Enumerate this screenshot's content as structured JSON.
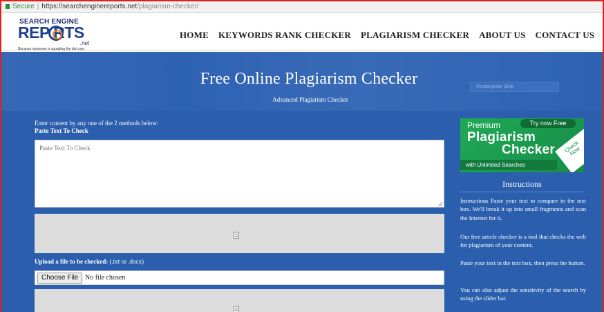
{
  "browser": {
    "secure_label": "Secure",
    "url_host": "https://searchenginereports.net",
    "url_path": "/plagiarism-checker/"
  },
  "logo": {
    "line1": "SEARCH      ENGINE",
    "line2": "REP    RTS",
    "line3": ".net",
    "tagline": "Because someone is squatting the dot com."
  },
  "nav": {
    "items": [
      "HOME",
      "KEYWORDS RANK CHECKER",
      "PLAGIARISM CHECKER",
      "ABOUT US",
      "CONTACT US"
    ]
  },
  "hero": {
    "title": "Free Online Plagiarism Checker",
    "subtitle": "Advanced Plagiarism Checker",
    "promo_text": "Rectangular Strip"
  },
  "main": {
    "intro": "Enter content by any one of the 2 methods below:",
    "paste_heading": "Paste Text To Check",
    "textarea_placeholder": "Paste Text To Check",
    "upload_label": "Upload a file to be checked:",
    "upload_hint": "(.txt or .docx)",
    "choose_file": "Choose File",
    "no_file": "No file chosen"
  },
  "sidebar": {
    "ad": {
      "premium": "Premium",
      "try_now": "Try now Free",
      "plagiarism": "Plagiarism",
      "checker": "Checker",
      "unlimited": "with Unlimited Searches",
      "check_now": "Check Now"
    },
    "instructions_title": "Instructions",
    "instructions": [
      "Instructions Paste your text to compare in the text box. We'll break it up into small fragments and scan the Internet for it.",
      "Our free article checker is a tool that checks the web for plagiarism of your content.",
      "Paste your text in the text box, then press the button.",
      "You can also adjust the sensitivity of the search by using the slider bar."
    ]
  },
  "colors": {
    "frame_border": "#e0201b",
    "hero_blue": "#2e62b3",
    "main_blue": "#2b5fae",
    "ad_green": "#1c9a4e"
  }
}
